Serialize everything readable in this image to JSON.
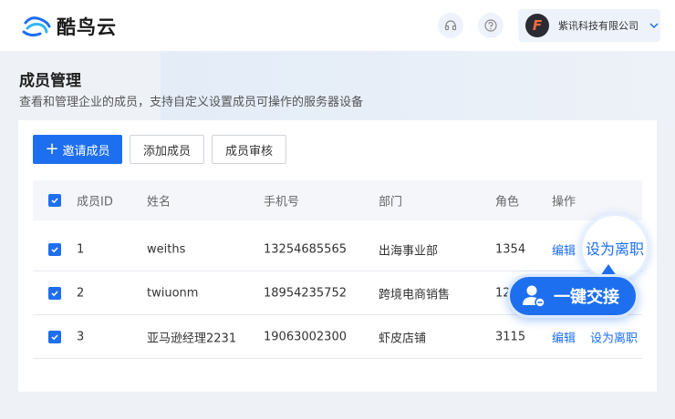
{
  "brand": {
    "name": "酷鸟云",
    "accent": "#1e6ff0"
  },
  "header": {
    "company_initial": "F",
    "company_name": "紫讯科技有限公司"
  },
  "page": {
    "title": "成员管理",
    "description": "查看和管理企业的成员，支持自定义设置成员可操作的服务器设备"
  },
  "toolbar": {
    "invite_label": "邀请成员",
    "add_label": "添加成员",
    "review_label": "成员审核"
  },
  "table": {
    "columns": [
      "成员ID",
      "姓名",
      "手机号",
      "部门",
      "角色",
      "操作"
    ],
    "rows": [
      {
        "id": "1",
        "name": "weiths",
        "phone": "13254685565",
        "dept": "出海事业部",
        "role": "1354",
        "edit": "编辑"
      },
      {
        "id": "2",
        "name": "twiuonm",
        "phone": "18954235752",
        "dept": "跨境电商销售",
        "role": "12"
      },
      {
        "id": "3",
        "name": "亚马逊经理2231",
        "phone": "19063002300",
        "dept": "虾皮店铺",
        "role": "3115",
        "edit": "编辑",
        "leave": "设为离职"
      }
    ]
  },
  "callouts": {
    "set_leave": "设为离职",
    "one_click_transfer": "一键交接"
  },
  "icons": [
    "headset-icon",
    "help-icon",
    "chevron-down-icon",
    "plus-icon",
    "checkbox-checked-icon",
    "user-transfer-icon"
  ]
}
